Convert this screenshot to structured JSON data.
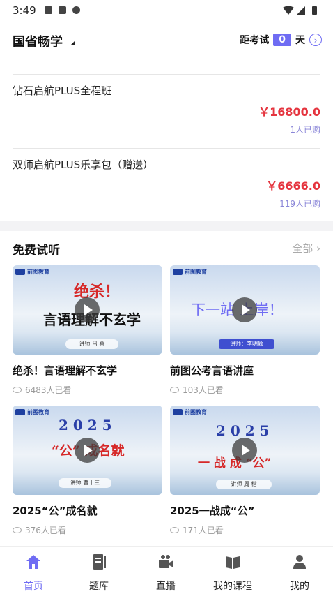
{
  "status_bar": {
    "time": "3:49"
  },
  "header": {
    "brand": "国省畅学",
    "exam_countdown": {
      "prefix": "距考试",
      "days": "0",
      "suffix": "天"
    }
  },
  "courses": [
    {
      "name": "钻石启航PLUS全程班",
      "price": "￥16800.0",
      "buyers": "1人已购"
    },
    {
      "name": "双师启航PLUS乐享包（赠送）",
      "price": "￥6666.0",
      "buyers": "119人已购"
    }
  ],
  "free_trial": {
    "title": "免费试听",
    "more": "全部",
    "videos": [
      {
        "title": "绝杀！言语理解不玄学",
        "views": "6483人已看",
        "thumb_line1": "绝杀！",
        "thumb_line2": "言语理解不玄学",
        "thumb_line3": "讲师 吕 蔡",
        "logo": "前图教育"
      },
      {
        "title": "前图公考言语讲座",
        "views": "103人已看",
        "thumb_line1": "下一站 上岸！",
        "thumb_line3": "讲师：李明颖",
        "logo": "前图教育"
      },
      {
        "title": "2025“公”成名就",
        "views": "376人已看",
        "thumb_line1": "2 0 2 5",
        "thumb_line2": "“公” 成名就",
        "thumb_line3": "讲师 曹十三",
        "logo": "前图教育"
      },
      {
        "title": "2025一战成“公”",
        "views": "171人已看",
        "thumb_line1": "2 0 2 5",
        "thumb_line2": "一 战 成 “公”",
        "thumb_line3": "讲师 周 楷",
        "logo": "前图教育"
      }
    ]
  },
  "tabs": [
    {
      "label": "首页",
      "icon": "home-icon",
      "active": true
    },
    {
      "label": "题库",
      "icon": "question-bank-icon",
      "active": false
    },
    {
      "label": "直播",
      "icon": "live-icon",
      "active": false
    },
    {
      "label": "我的课程",
      "icon": "my-courses-icon",
      "active": false
    },
    {
      "label": "我的",
      "icon": "profile-icon",
      "active": false
    }
  ],
  "colors": {
    "accent": "#6f6cf3",
    "price": "#e5353f",
    "buyers": "#8a86d8"
  }
}
